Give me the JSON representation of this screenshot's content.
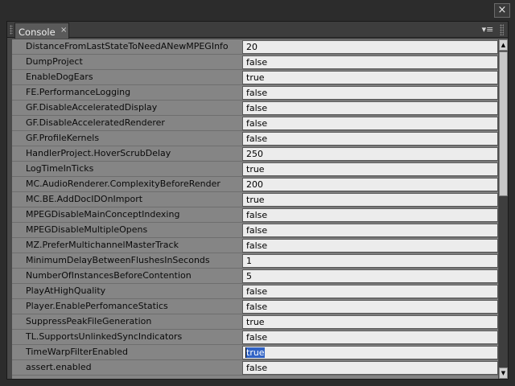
{
  "window": {
    "close_glyph": "×"
  },
  "tab": {
    "label": "Console",
    "close_glyph": "×",
    "menu_glyph": "▾≡"
  },
  "rows": [
    {
      "name": "DistanceFromLastStateToNeedANewMPEGInfo",
      "value": "20"
    },
    {
      "name": "DumpProject",
      "value": "false"
    },
    {
      "name": "EnableDogEars",
      "value": "true"
    },
    {
      "name": "FE.PerformanceLogging",
      "value": "false"
    },
    {
      "name": "GF.DisableAcceleratedDisplay",
      "value": "false"
    },
    {
      "name": "GF.DisableAcceleratedRenderer",
      "value": "false"
    },
    {
      "name": "GF.ProfileKernels",
      "value": "false"
    },
    {
      "name": "HandlerProject.HoverScrubDelay",
      "value": "250"
    },
    {
      "name": "LogTimeInTicks",
      "value": "true"
    },
    {
      "name": "MC.AudioRenderer.ComplexityBeforeRender",
      "value": "200"
    },
    {
      "name": "MC.BE.AddDocIDOnImport",
      "value": "true"
    },
    {
      "name": "MPEGDisableMainConceptIndexing",
      "value": "false"
    },
    {
      "name": "MPEGDisableMultipleOpens",
      "value": "false"
    },
    {
      "name": "MZ.PreferMultichannelMasterTrack",
      "value": "false"
    },
    {
      "name": "MinimumDelayBetweenFlushesInSeconds",
      "value": "1"
    },
    {
      "name": "NumberOfInstancesBeforeContention",
      "value": "5"
    },
    {
      "name": "PlayAtHighQuality",
      "value": "false"
    },
    {
      "name": "Player.EnablePerfomanceStatics",
      "value": "false"
    },
    {
      "name": "SuppressPeakFileGeneration",
      "value": "true"
    },
    {
      "name": "TL.SupportsUnlinkedSyncIndicators",
      "value": "false"
    },
    {
      "name": "TimeWarpFilterEnabled",
      "value": "true",
      "selected": true
    },
    {
      "name": "assert.enabled",
      "value": "false"
    }
  ],
  "scrollbar": {
    "up_glyph": "▲",
    "down_glyph": "▼"
  }
}
